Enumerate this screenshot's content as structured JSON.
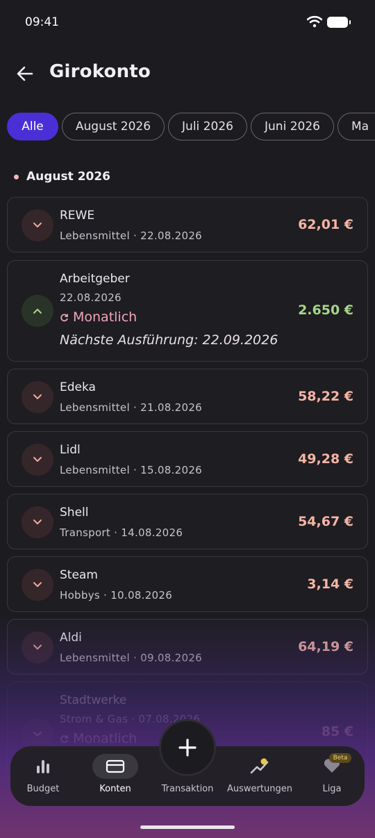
{
  "status_bar": {
    "time": "09:41"
  },
  "header": {
    "title": "Girokonto"
  },
  "filters": [
    "Alle",
    "August 2026",
    "Juli 2026",
    "Juni 2026",
    "Ma"
  ],
  "section": {
    "label": "August 2026"
  },
  "transactions": [
    {
      "name": "REWE",
      "meta": "Lebensmittel · 22.08.2026",
      "amount": "62,01 €",
      "type": "expense"
    },
    {
      "name": "Arbeitgeber",
      "meta": "22.08.2026",
      "amount": "2.650 €",
      "type": "income",
      "recurrence": "Monatlich",
      "next": "Nächste Ausführung: 22.09.2026"
    },
    {
      "name": "Edeka",
      "meta": "Lebensmittel · 21.08.2026",
      "amount": "58,22 €",
      "type": "expense"
    },
    {
      "name": "Lidl",
      "meta": "Lebensmittel · 15.08.2026",
      "amount": "49,28 €",
      "type": "expense"
    },
    {
      "name": "Shell",
      "meta": "Transport · 14.08.2026",
      "amount": "54,67 €",
      "type": "expense"
    },
    {
      "name": "Steam",
      "meta": "Hobbys · 10.08.2026",
      "amount": "3,14 €",
      "type": "expense"
    },
    {
      "name": "Aldi",
      "meta": "Lebensmittel · 09.08.2026",
      "amount": "64,19 €",
      "type": "expense"
    },
    {
      "name": "Stadtwerke",
      "meta": "Strom & Gas · 07.08.2026",
      "amount": "85 €",
      "type": "expense",
      "recurrence": "Monatlich"
    }
  ],
  "bottom_nav": {
    "items": [
      {
        "label": "Budget",
        "icon": "bar-chart-icon"
      },
      {
        "label": "Konten",
        "icon": "card-icon",
        "active": true
      },
      {
        "label": "Transaktion",
        "icon": "plus-icon"
      },
      {
        "label": "Auswertungen",
        "icon": "trend-icon"
      },
      {
        "label": "Liga",
        "icon": "heart-icon",
        "badge": "Beta"
      }
    ]
  },
  "colors": {
    "accent": "#4a2fd6",
    "expense": "#f5b5a6",
    "income": "#a6d68a",
    "recurrence": "#f0a7b7"
  }
}
